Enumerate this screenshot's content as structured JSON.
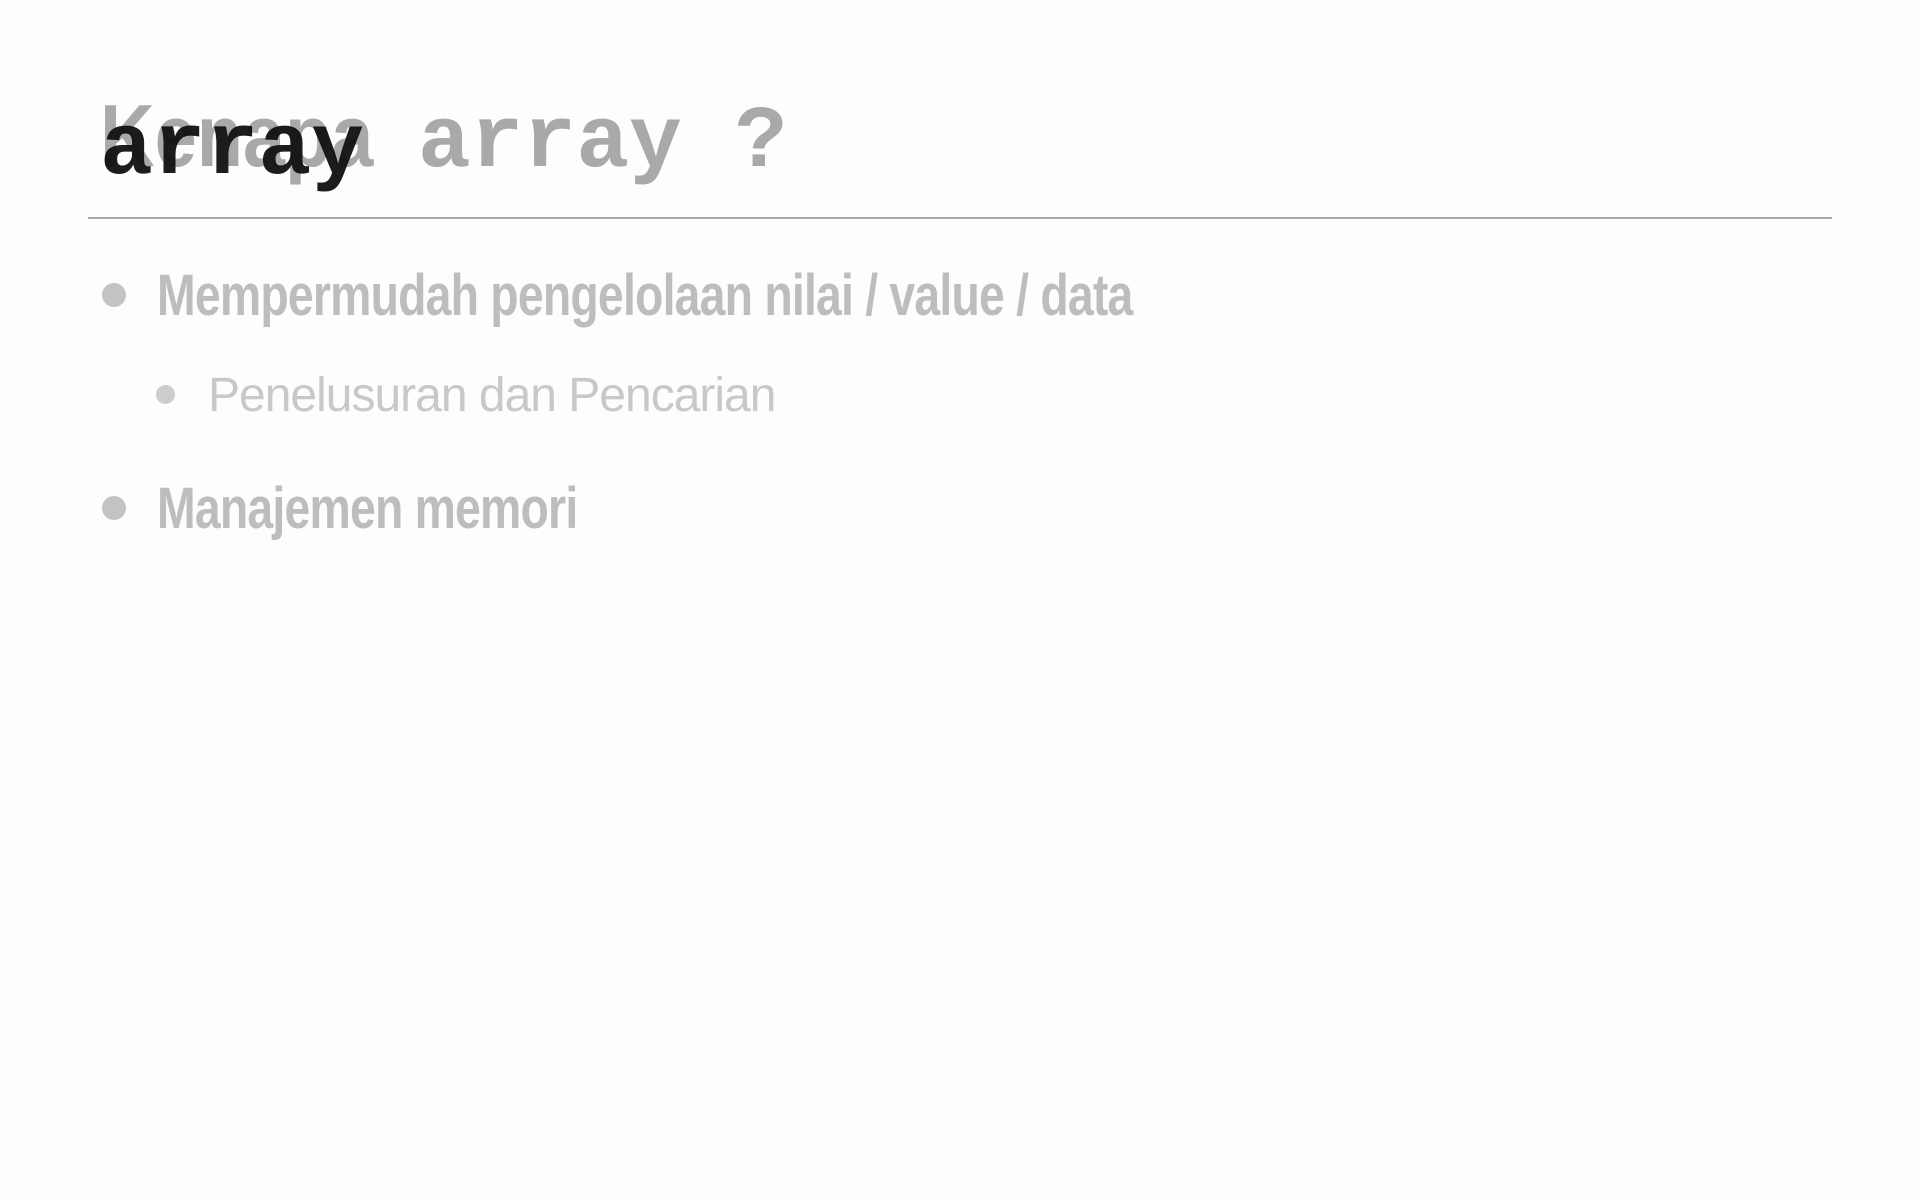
{
  "slide": {
    "title_previous": {
      "word": "Kenapa",
      "code": "array",
      "suffix": "?"
    },
    "title_current": "array",
    "bullets": [
      {
        "text": "Mempermudah pengelolaan nilai / value / data",
        "sub": [
          "Penelusuran dan Pencarian"
        ]
      },
      {
        "text": "Manajemen memori",
        "sub": []
      }
    ]
  },
  "colors": {
    "title_faded": "#a9a9a9",
    "title_current": "#111111",
    "bullet_text": "#bdbdbd"
  }
}
